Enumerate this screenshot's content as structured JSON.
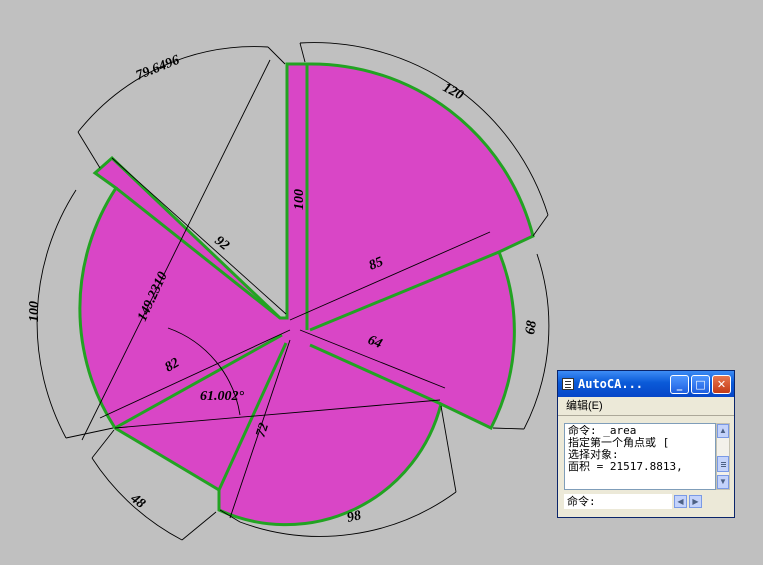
{
  "drawing": {
    "fill_color": "#d946c6",
    "edge_color": "#22a322",
    "dimensions": {
      "d_79": "79.6496",
      "d_120": "120",
      "d_100_top": "100",
      "d_92": "92",
      "d_85": "85",
      "d_149": "149.2310",
      "d_100_left": "100",
      "d_68": "68",
      "d_64": "64",
      "d_82": "82",
      "d_angle": "61.002°",
      "d_72": "72",
      "d_48": "48",
      "d_98": "98"
    }
  },
  "command_window": {
    "title": "AutoCA...",
    "menu": "编辑(E)",
    "lines": [
      "命令: _area",
      "指定第一个角点或 [",
      "选择对象:",
      "面积 = 21517.8813,"
    ],
    "prompt": "命令:",
    "icons": {
      "app": "autocad-icon",
      "minimize": "minimize-icon",
      "maximize": "maximize-icon",
      "close": "close-icon"
    }
  }
}
